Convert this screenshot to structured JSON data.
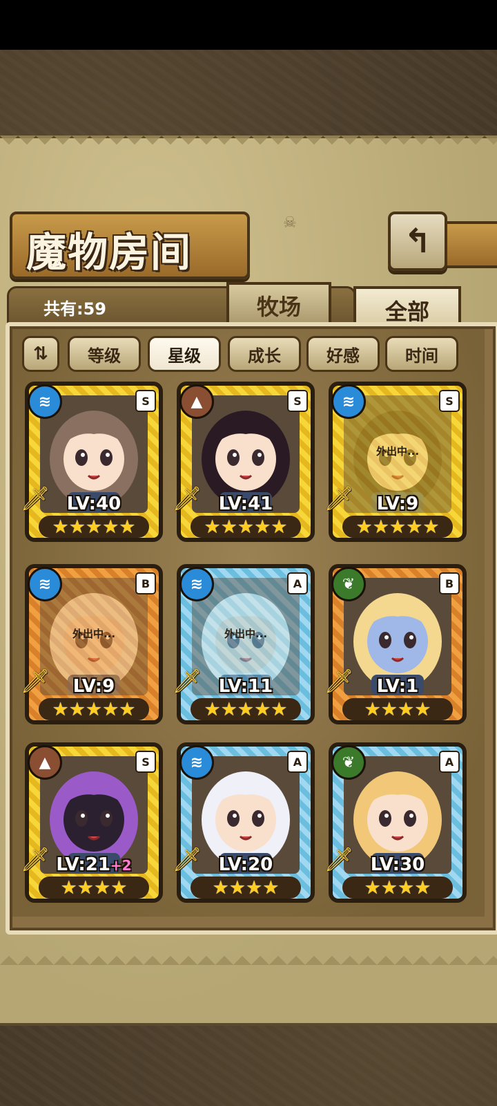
{
  "header": {
    "title": "魔物房间",
    "back_icon": "↰"
  },
  "summary": {
    "count_label": "共有:59"
  },
  "tabs": [
    {
      "label": "牧场",
      "active": false
    },
    {
      "label": "全部",
      "active": true
    }
  ],
  "filters": {
    "toggle_icon": "⇅",
    "items": [
      {
        "label": "等级",
        "active": false
      },
      {
        "label": "星级",
        "active": true
      },
      {
        "label": "成长",
        "active": false
      },
      {
        "label": "好感",
        "active": false
      },
      {
        "label": "时间",
        "active": false
      }
    ]
  },
  "monsters": [
    {
      "level": "LV:40",
      "plus": "",
      "stars": "★★★★★",
      "rank": "S",
      "element": "water",
      "frame": "gold",
      "away": "",
      "hair": "#8a7060",
      "skin": "#f8e0cc"
    },
    {
      "level": "LV:41",
      "plus": "",
      "stars": "★★★★★",
      "rank": "S",
      "element": "earth",
      "frame": "gold",
      "away": "",
      "hair": "#2a1a24",
      "skin": "#f8e0cc"
    },
    {
      "level": "LV:9",
      "plus": "",
      "stars": "★★★★★",
      "rank": "S",
      "element": "water",
      "frame": "gold",
      "away": "外出中...",
      "hair": "#3a2a20",
      "skin": "#f0d4b8"
    },
    {
      "level": "LV:9",
      "plus": "",
      "stars": "★★★★★",
      "rank": "B",
      "element": "water",
      "frame": "bronze",
      "away": "外出中...",
      "hair": "#e8e0d0",
      "skin": "#f0d4b8"
    },
    {
      "level": "LV:11",
      "plus": "",
      "stars": "★★★★★",
      "rank": "A",
      "element": "water",
      "frame": "silver",
      "away": "外出中...",
      "hair": "#f0ece0",
      "skin": "#f0d4b8"
    },
    {
      "level": "LV:1",
      "plus": "",
      "stars": "★★★★",
      "rank": "B",
      "element": "leaf",
      "frame": "bronze",
      "away": "",
      "hair": "#f4d890",
      "skin": "#a0b8e8"
    },
    {
      "level": "LV:21",
      "plus": "+2",
      "stars": "★★★★",
      "rank": "S",
      "element": "earth",
      "frame": "gold",
      "away": "",
      "hair": "#9a5ac8",
      "skin": "#2a2030"
    },
    {
      "level": "LV:20",
      "plus": "",
      "stars": "★★★★",
      "rank": "A",
      "element": "water",
      "frame": "silver",
      "away": "",
      "hair": "#f0f0f8",
      "skin": "#f8e0cc"
    },
    {
      "level": "LV:30",
      "plus": "",
      "stars": "★★★★",
      "rank": "A",
      "element": "leaf",
      "frame": "silver",
      "away": "",
      "hair": "#f2c878",
      "skin": "#f8e0cc"
    }
  ]
}
